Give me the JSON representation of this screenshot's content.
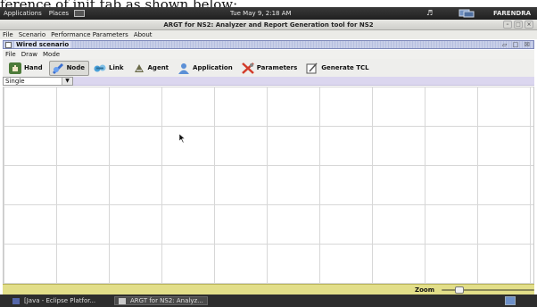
{
  "caption": "ference of init tab as shown below:",
  "top_panel": {
    "menus": [
      "Applications",
      "Places"
    ],
    "clock": "Tue May  9,  2:18 AM",
    "volume_icon": "speaker-icon",
    "user": "FARENDRA"
  },
  "app": {
    "title": "ARGT for NS2: Analyzer and Report Generation tool for NS2",
    "menu": [
      "File",
      "Scenario",
      "Performance Parameters",
      "About"
    ]
  },
  "frame": {
    "title": "Wired scenario",
    "controls": "▱ □ ☒",
    "menu": [
      "File",
      "Draw",
      "Mode"
    ]
  },
  "toolbar": {
    "buttons": [
      {
        "label": "Hand",
        "icon": "hand-icon",
        "color": "#4d7b3a"
      },
      {
        "label": "Node",
        "icon": "node-icon",
        "color": "#3a6fd0"
      },
      {
        "label": "Link",
        "icon": "link-icon",
        "color": "#4aa0d8"
      },
      {
        "label": "Agent",
        "icon": "agent-icon",
        "color": "#6b6b4a"
      },
      {
        "label": "Application",
        "icon": "application-icon",
        "color": "#5b8fd6"
      },
      {
        "label": "Parameters",
        "icon": "parameters-icon",
        "color": "#d23b2a"
      },
      {
        "label": "Generate TCL",
        "icon": "generate-tcl-icon",
        "color": "#555555"
      }
    ],
    "active": "Node"
  },
  "mode_select": {
    "value": "Single"
  },
  "status": {
    "zoom_label": "Zoom"
  },
  "taskbar": {
    "tasks": [
      "[Java - Eclipse Platfor...",
      "ARGT for NS2: Analyz..."
    ]
  },
  "colors": {
    "mode_bar": "#dbd6ef",
    "status_bar": "#e2de89",
    "frame_title": "#c8cfe8"
  }
}
